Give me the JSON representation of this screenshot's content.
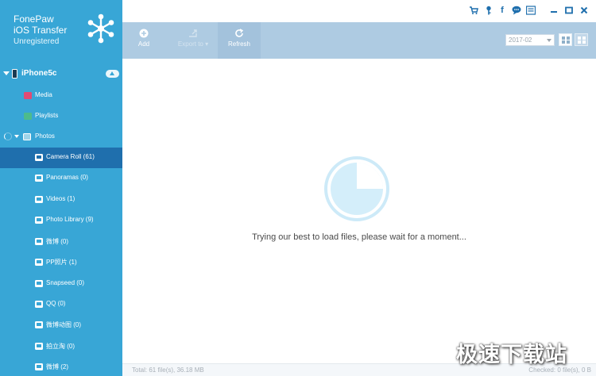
{
  "app": {
    "name_line1": "FonePaw",
    "name_line2": "iOS Transfer",
    "license": "Unregistered"
  },
  "device": {
    "name": "iPhone5c"
  },
  "sidebar": {
    "items": [
      {
        "label": "Media"
      },
      {
        "label": "Playlists"
      },
      {
        "label": "Photos"
      },
      {
        "label": "Camera Roll (61)"
      },
      {
        "label": "Panoramas (0)"
      },
      {
        "label": "Videos (1)"
      },
      {
        "label": "Photo Library (9)"
      },
      {
        "label": "微博 (0)"
      },
      {
        "label": "PP照片 (1)"
      },
      {
        "label": "Snapseed (0)"
      },
      {
        "label": "QQ (0)"
      },
      {
        "label": "微博动图 (0)"
      },
      {
        "label": "拍立淘 (0)"
      },
      {
        "label": "微博 (2)"
      }
    ],
    "active_item": "Camera Roll (61)"
  },
  "toolbar": {
    "add_label": "Add",
    "export_label": "Export to",
    "refresh_label": "Refresh",
    "date_value": "2017-02"
  },
  "window_icons": [
    "cart-icon",
    "key-icon",
    "facebook-icon",
    "chat-icon",
    "menu-icon",
    "minimize-icon",
    "maximize-icon",
    "close-icon"
  ],
  "main": {
    "loading_text": "Trying our best to load files, please wait for a moment...",
    "loader_progress": 0.25
  },
  "status": {
    "total": "Total: 61 file(s), 36.18 MB",
    "checked": "Checked: 0 file(s), 0 B"
  },
  "watermark": "极速下载站",
  "colors": {
    "sidebar": "#38a6d6",
    "active": "#1f6fad",
    "toolbar": "#aecbe2",
    "loader": "#d4eefa"
  }
}
